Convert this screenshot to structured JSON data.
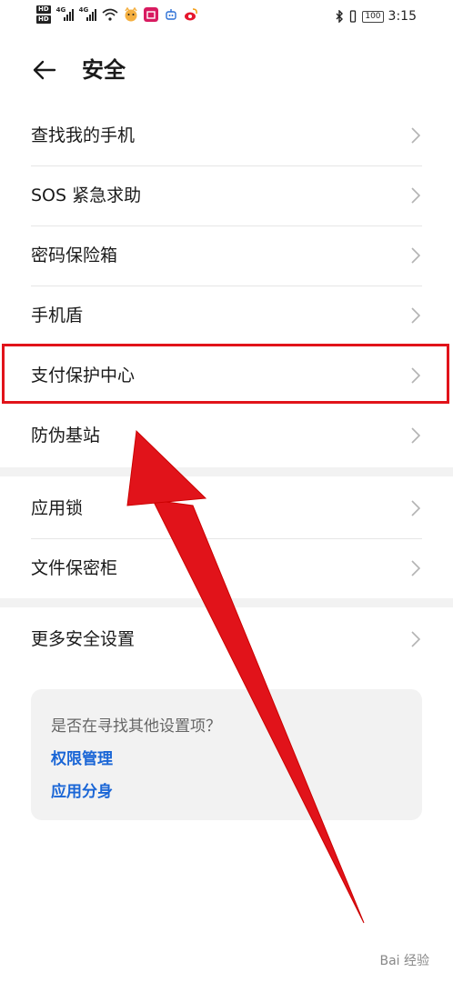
{
  "status_bar": {
    "hd1": "HD",
    "hd2": "HD",
    "net1": "4G",
    "net2": "4G",
    "battery": "100",
    "time": "3:15"
  },
  "header": {
    "title": "安全"
  },
  "sections": [
    {
      "items": [
        {
          "label": "查找我的手机"
        },
        {
          "label": "SOS 紧急求助"
        },
        {
          "label": "密码保险箱"
        },
        {
          "label": "手机盾"
        },
        {
          "label": "支付保护中心"
        },
        {
          "label": "防伪基站"
        }
      ]
    },
    {
      "items": [
        {
          "label": "应用锁"
        },
        {
          "label": "文件保密柜"
        }
      ]
    },
    {
      "items": [
        {
          "label": "更多安全设置"
        }
      ]
    }
  ],
  "suggestion_card": {
    "question": "是否在寻找其他设置项？",
    "links": [
      "权限管理",
      "应用分身"
    ]
  },
  "watermark": "Bai 经验",
  "colors": {
    "highlight": "#e1131a",
    "link": "#1a66d6",
    "divider": "#e6e6e6"
  }
}
